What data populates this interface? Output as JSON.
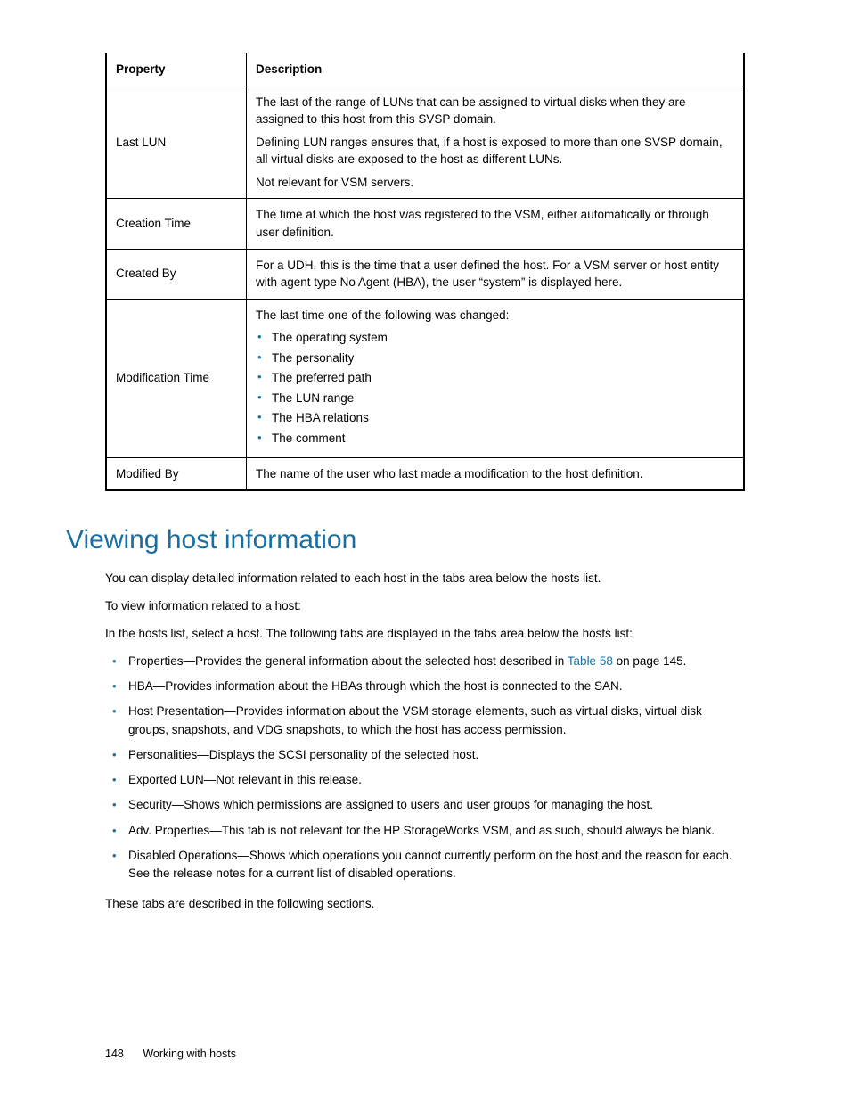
{
  "table": {
    "headers": {
      "property": "Property",
      "description": "Description"
    },
    "rows": [
      {
        "property": "Last LUN",
        "paras": [
          "The last of the range of LUNs that can be assigned to virtual disks when they are assigned to this host from this SVSP domain.",
          "Defining LUN ranges ensures that, if a host is exposed to more than one SVSP domain, all virtual disks are exposed to the host as different LUNs.",
          "Not relevant for VSM servers."
        ]
      },
      {
        "property": "Creation Time",
        "paras": [
          "The time at which the host was registered to the VSM, either automatically or through user definition."
        ]
      },
      {
        "property": "Created By",
        "paras": [
          "For a UDH, this is the time that a user defined the host. For a VSM server or host entity with agent type No Agent (HBA), the user “system” is displayed here."
        ]
      },
      {
        "property": "Modification Time",
        "lead": "The last time one of the following was changed:",
        "items": [
          "The operating system",
          "The personality",
          "The preferred path",
          "The LUN range",
          "The HBA relations",
          "The comment"
        ]
      },
      {
        "property": "Modified By",
        "paras": [
          "The name of the user who last made a modification to the host definition."
        ]
      }
    ]
  },
  "section": {
    "heading": "Viewing host information",
    "intro1": "You can display detailed information related to each host in the tabs area below the hosts list.",
    "intro2": "To view information related to a host:",
    "intro3": "In the hosts list, select a host. The following tabs are displayed in the tabs area below the hosts list:",
    "bullets": {
      "b0_pre": "Properties—Provides the general information about the selected host described in ",
      "b0_link": "Table 58",
      "b0_post": " on page 145.",
      "b1": "HBA—Provides information about the HBAs through which the host is connected to the SAN.",
      "b2": "Host Presentation—Provides information about the VSM storage elements, such as virtual disks, virtual disk groups, snapshots, and VDG snapshots, to which the host has access permission.",
      "b3": "Personalities—Displays the SCSI personality of the selected host.",
      "b4": "Exported LUN—Not relevant in this release.",
      "b5": "Security—Shows which permissions are assigned to users and user groups for managing the host.",
      "b6": "Adv. Properties—This tab is not relevant for the HP StorageWorks VSM, and as such, should always be blank.",
      "b7": "Disabled Operations—Shows which operations you cannot currently perform on the host and the reason for each. See the release notes for a current list of disabled operations."
    },
    "closing": "These tabs are described in the following sections."
  },
  "footer": {
    "page": "148",
    "title": "Working with hosts"
  }
}
